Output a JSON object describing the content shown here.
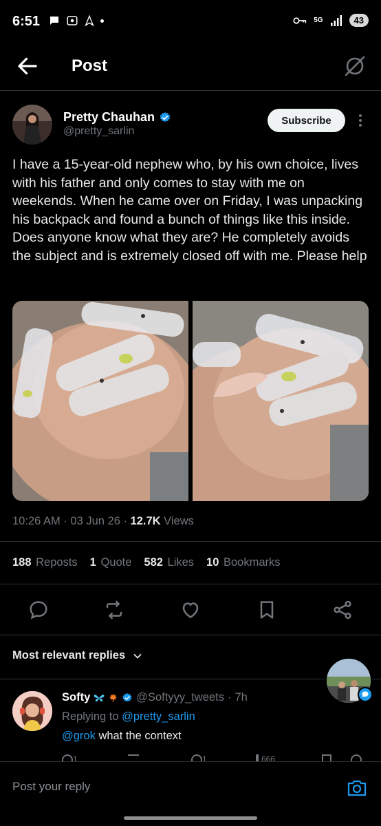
{
  "status_bar": {
    "time": "6:51",
    "network": "5G",
    "battery": "43"
  },
  "topbar": {
    "title": "Post"
  },
  "author": {
    "name": "Pretty Chauhan",
    "handle": "@pretty_sarlin",
    "verified": true,
    "subscribe_label": "Subscribe"
  },
  "post": {
    "text": "I have a 15-year-old nephew who, by his own choice, lives with his father and only comes to stay with me on weekends. When he came over on Friday, I was unpacking his backpack and found a bunch of things like this inside. Does anyone know what they are? He completely avoids the subject and is extremely closed off with me. Please help",
    "time": "10:26 AM",
    "date": "03 Jun 26",
    "views_count": "12.7K",
    "views_label": "Views"
  },
  "stats": [
    {
      "count": "188",
      "label": "Reposts"
    },
    {
      "count": "1",
      "label": "Quote"
    },
    {
      "count": "582",
      "label": "Likes"
    },
    {
      "count": "10",
      "label": "Bookmarks"
    }
  ],
  "replies_filter": "Most relevant replies",
  "reply": {
    "name": "Softy",
    "handle": "@Softyyy_tweets",
    "age": "7h",
    "replying_prefix": "Replying to",
    "replying_to": "@pretty_sarlin",
    "mention": "@grok",
    "body": "what the context",
    "counts": [
      "1",
      "",
      "1",
      "666"
    ]
  },
  "composer": {
    "placeholder": "Post your reply"
  },
  "colors": {
    "accent": "#1d9bf0",
    "background": "#000000",
    "muted": "#71767b"
  }
}
